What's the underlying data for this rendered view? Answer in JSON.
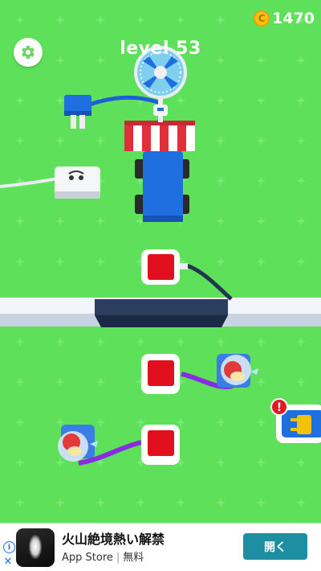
{
  "hud": {
    "level_label": "level 53",
    "coin_count": "1470",
    "coin_symbol": "C",
    "settings_icon": "gear-icon",
    "coin_icon": "coin-icon"
  },
  "board": {
    "goal_machine": "fan-on-truck",
    "alert_mark": "!",
    "plug_socket_icon": "plug-icon"
  },
  "ad": {
    "title": "火山絶境熱い解禁",
    "store": "App Store",
    "price": "無料",
    "button_label": "開く",
    "info_icon": "info-icon",
    "close_icon": "close-icon"
  },
  "colors": {
    "grass": "#5ee05a",
    "grass_dark": "#52d24e",
    "wall": "#223654",
    "red_button": "#e0101e",
    "plug_blue": "#1f6fe0",
    "wire_purple": "#8a2be2",
    "ad_button": "#1e8fa3"
  }
}
